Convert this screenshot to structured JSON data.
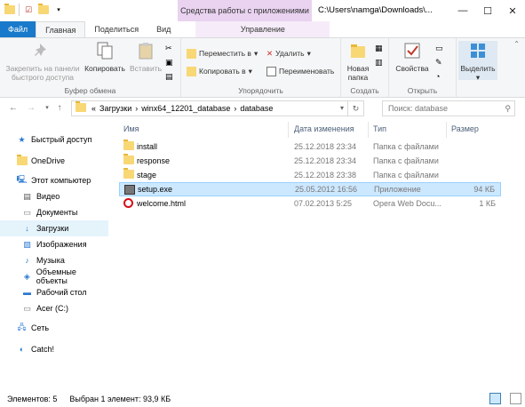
{
  "title_bar": {
    "context_tab_title": "Средства работы с приложениями",
    "path": "C:\\Users\\namga\\Downloads\\...",
    "minimize": "—",
    "maximize": "☐",
    "close": "✕"
  },
  "ribbon_tabs": {
    "file": "Файл",
    "home": "Главная",
    "share": "Поделиться",
    "view": "Вид",
    "manage": "Управление"
  },
  "ribbon": {
    "clipboard": {
      "label": "Буфер обмена",
      "pin": "Закрепить на панели быстрого доступа",
      "copy": "Копировать",
      "paste": "Вставить"
    },
    "organize": {
      "label": "Упорядочить",
      "move_to": "Переместить в",
      "copy_to": "Копировать в",
      "delete": "Удалить",
      "rename": "Переименовать"
    },
    "new": {
      "label": "Создать",
      "new_folder": "Новая папка"
    },
    "open": {
      "label": "Открыть",
      "properties": "Свойства"
    },
    "select": {
      "label": "Выделить"
    }
  },
  "address_bar": {
    "prefix": "«",
    "crumbs": [
      "Загрузки",
      "winx64_12201_database",
      "database"
    ],
    "separator": "›",
    "search_placeholder": "Поиск: database"
  },
  "nav_pane": {
    "items": [
      {
        "label": "Быстрый доступ",
        "icon": "star-icon"
      },
      {
        "label": "OneDrive",
        "icon": "folder-icon"
      },
      {
        "label": "Этот компьютер",
        "icon": "computer-icon"
      },
      {
        "label": "Видео",
        "icon": "video-icon"
      },
      {
        "label": "Документы",
        "icon": "documents-icon"
      },
      {
        "label": "Загрузки",
        "icon": "download-icon"
      },
      {
        "label": "Изображения",
        "icon": "pictures-icon"
      },
      {
        "label": "Музыка",
        "icon": "music-icon"
      },
      {
        "label": "Объемные объекты",
        "icon": "3d-objects-icon"
      },
      {
        "label": "Рабочий стол",
        "icon": "desktop-icon"
      },
      {
        "label": "Acer (C:)",
        "icon": "drive-icon"
      },
      {
        "label": "Сеть",
        "icon": "network-icon"
      },
      {
        "label": "Catch!",
        "icon": "catch-icon"
      }
    ]
  },
  "file_list": {
    "columns": {
      "name": "Имя",
      "date": "Дата изменения",
      "type": "Тип",
      "size": "Размер"
    },
    "rows": [
      {
        "name": "install",
        "date": "25.12.2018 23:34",
        "type": "Папка с файлами",
        "size": "",
        "icon": "folder-icon"
      },
      {
        "name": "response",
        "date": "25.12.2018 23:34",
        "type": "Папка с файлами",
        "size": "",
        "icon": "folder-icon"
      },
      {
        "name": "stage",
        "date": "25.12.2018 23:38",
        "type": "Папка с файлами",
        "size": "",
        "icon": "folder-icon"
      },
      {
        "name": "setup.exe",
        "date": "25.05.2012 16:56",
        "type": "Приложение",
        "size": "94 КБ",
        "icon": "exe-icon"
      },
      {
        "name": "welcome.html",
        "date": "07.02.2013 5:25",
        "type": "Opera Web Docu...",
        "size": "1 КБ",
        "icon": "opera-icon"
      }
    ]
  },
  "status_bar": {
    "count": "Элементов: 5",
    "selection": "Выбран 1 элемент: 93,9 КБ"
  },
  "colors": {
    "file_tab": "#1979ca",
    "context_tab": "#e9d3f0",
    "selection": "#cce8ff"
  }
}
